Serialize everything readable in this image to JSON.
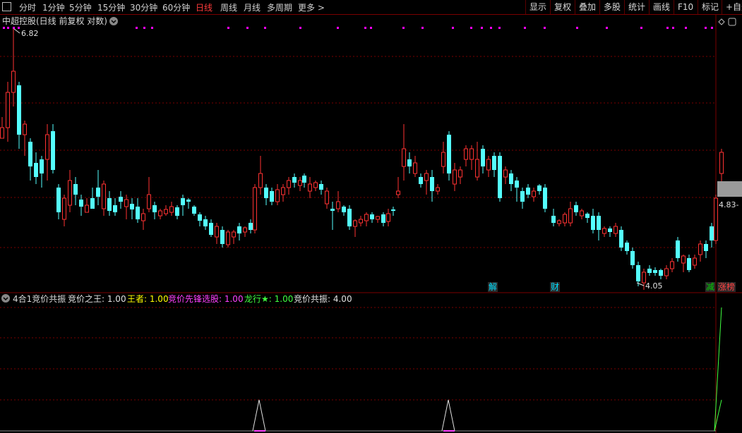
{
  "toolbar": {
    "periods": [
      "分时",
      "1分钟",
      "5分钟",
      "15分钟",
      "30分钟",
      "60分钟",
      "日线",
      "周线",
      "月线",
      "多周期",
      "更多 >"
    ],
    "active_period": "日线",
    "right_buttons": [
      "显示",
      "复权",
      "叠加",
      "多股",
      "统计",
      "画线",
      "F10",
      "标记",
      "+自选"
    ]
  },
  "main_panel": {
    "title": "中超控股(日线 前复权 对数)",
    "high_label": "6.82",
    "low_label": "4.05",
    "price_tag": "4.83",
    "event_labels": [
      {
        "text": "解",
        "color": "#00e0ff"
      },
      {
        "text": "财",
        "color": "#00e0ff"
      },
      {
        "text": "减",
        "color": "#00d000"
      },
      {
        "text": "涨榜",
        "color": "#ff4040"
      }
    ]
  },
  "indicator_panel": {
    "name": "4合1竞价共振",
    "items": [
      {
        "label": "竞价之王:",
        "value": "1.00",
        "color": "#e0e0e0"
      },
      {
        "label": "王者:",
        "value": "1.00",
        "color": "#ffff00"
      },
      {
        "label": "竞价先锋选股:",
        "value": "1.00",
        "color": "#ff40ff"
      },
      {
        "label": "龙行★:",
        "value": "1.00",
        "color": "#40ff40"
      },
      {
        "label": "竞价共振:",
        "value": "4.00",
        "color": "#e0e0e0"
      }
    ]
  },
  "colors": {
    "up": "#ff3232",
    "down": "#54ffff",
    "grid": "#7a0000",
    "marker": "#ff00ff"
  }
}
